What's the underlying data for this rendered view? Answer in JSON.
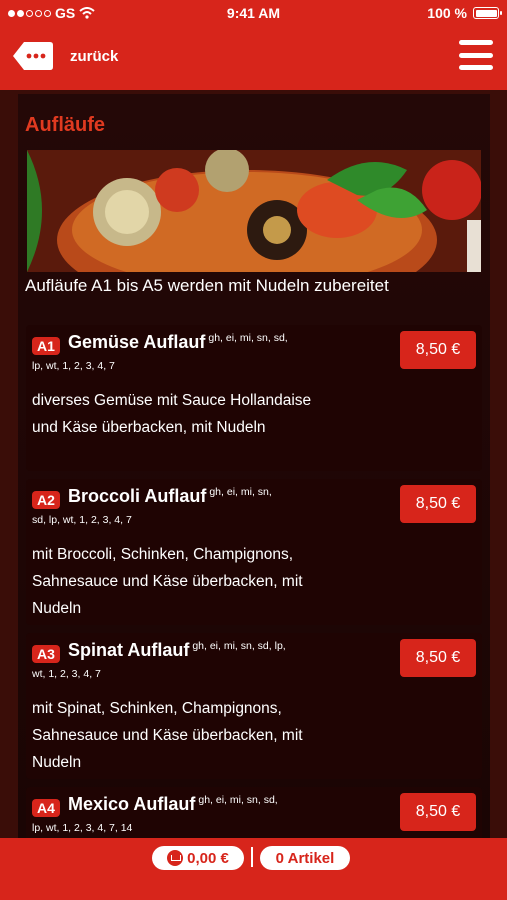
{
  "status_bar": {
    "carrier": "GS",
    "time": "9:41 AM",
    "battery": "100 %"
  },
  "nav": {
    "back_label": "zurück"
  },
  "section": {
    "title": "Aufläufe",
    "note": "Aufläufe A1 bis A5 werden mit Nudeln zubereitet"
  },
  "items": [
    {
      "code": "A1",
      "name": "Gemüse Auflauf",
      "allergens_line1": "gh, ei, mi, sn, sd,",
      "allergens_line2": "lp, wt, 1, 2, 3, 4, 7",
      "description": "diverses Gemüse mit Sauce Hollandaise und Käse überbacken, mit Nudeln",
      "price": "8,50 €"
    },
    {
      "code": "A2",
      "name": "Broccoli Auflauf",
      "allergens_line1": "gh, ei, mi, sn,",
      "allergens_line2": "sd, lp, wt, 1, 2, 3, 4, 7",
      "description": "mit Broccoli, Schinken, Champignons, Sahnesauce und Käse überbacken, mit Nudeln",
      "price": "8,50 €"
    },
    {
      "code": "A3",
      "name": "Spinat Auflauf",
      "allergens_line1": "gh, ei, mi, sn, sd, lp,",
      "allergens_line2": "wt, 1, 2, 3, 4, 7",
      "description": "mit Spinat, Schinken, Champignons, Sahnesauce und Käse überbacken, mit Nudeln",
      "price": "8,50 €"
    },
    {
      "code": "A4",
      "name": "Mexico Auflauf",
      "allergens_line1": "gh, ei, mi, sn, sd,",
      "allergens_line2": "lp, wt, 1, 2, 3, 4, 7, 14",
      "description": "",
      "price": "8,50 €"
    }
  ],
  "cart": {
    "total": "0,00 €",
    "count": "0 Artikel"
  },
  "colors": {
    "accent": "#d7251b",
    "background": "#1f0403"
  }
}
